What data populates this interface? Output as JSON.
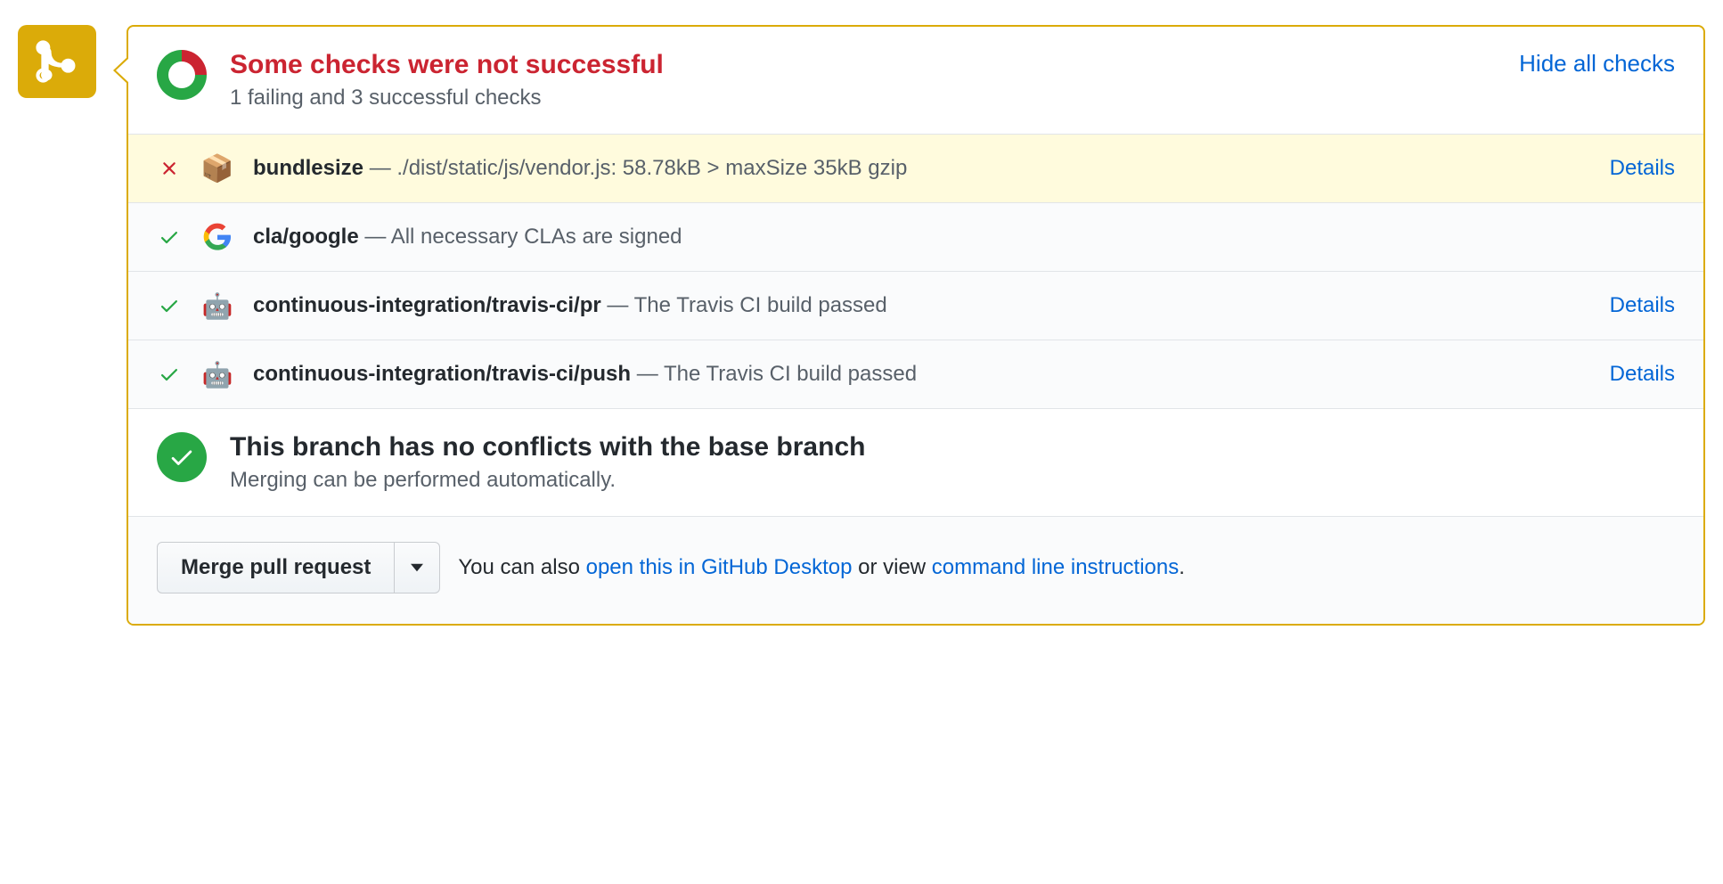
{
  "header": {
    "title": "Some checks were not successful",
    "subtitle": "1 failing and 3 successful checks",
    "hide_label": "Hide all checks"
  },
  "checks": [
    {
      "status": "fail",
      "icon": "package",
      "name": "bundlesize",
      "desc": "./dist/static/js/vendor.js: 58.78kB > maxSize 35kB gzip",
      "details_label": "Details",
      "has_details": true
    },
    {
      "status": "pass",
      "icon": "google",
      "name": "cla/google",
      "desc": "All necessary CLAs are signed",
      "has_details": false
    },
    {
      "status": "pass",
      "icon": "travis",
      "name": "continuous-integration/travis-ci/pr",
      "desc": "The Travis CI build passed",
      "details_label": "Details",
      "has_details": true
    },
    {
      "status": "pass",
      "icon": "travis",
      "name": "continuous-integration/travis-ci/push",
      "desc": "The Travis CI build passed",
      "details_label": "Details",
      "has_details": true
    }
  ],
  "conflicts": {
    "title": "This branch has no conflicts with the base branch",
    "subtitle": "Merging can be performed automatically."
  },
  "merge": {
    "button_label": "Merge pull request",
    "text_prefix": "You can also ",
    "link_desktop": "open this in GitHub Desktop",
    "text_mid": " or view ",
    "link_cli": "command line instructions",
    "text_suffix": "."
  }
}
